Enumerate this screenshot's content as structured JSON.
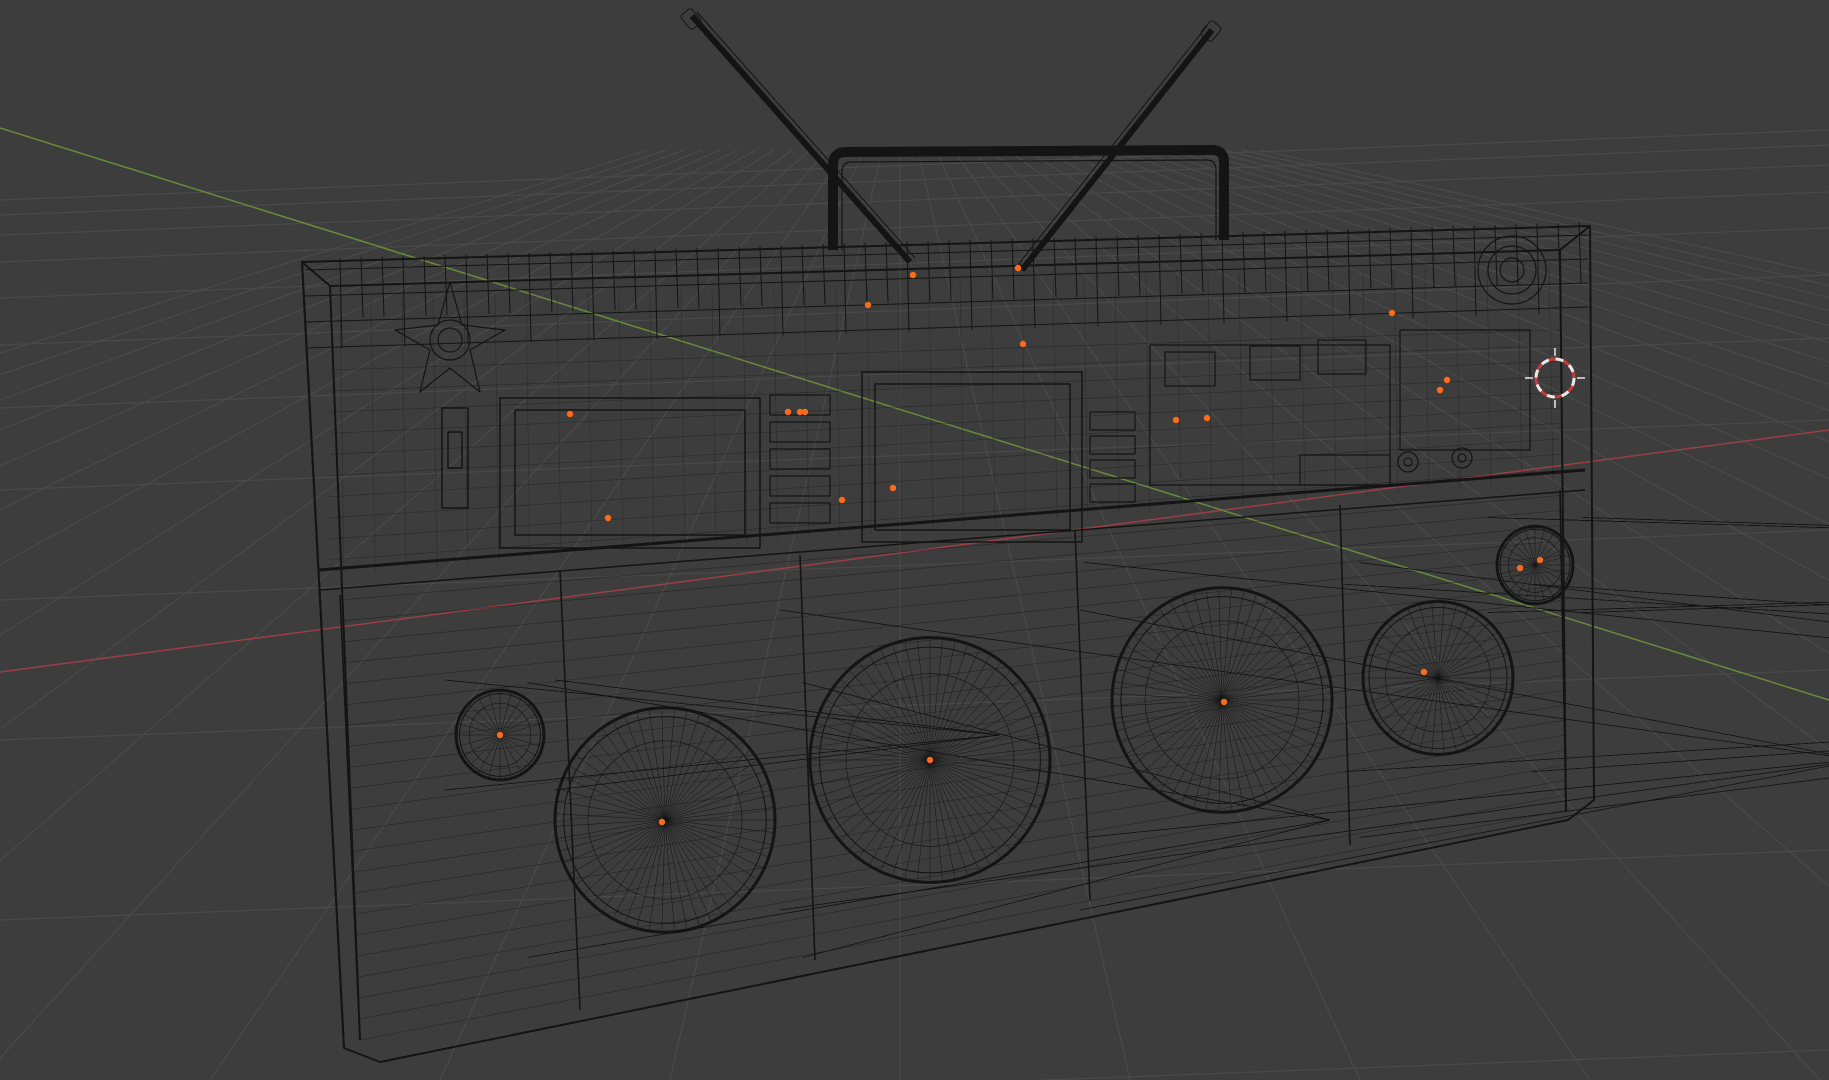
{
  "app": {
    "name": "3D viewport",
    "shading_mode": "wireframe",
    "object": "boombox"
  },
  "colors": {
    "background": "#3d3d3d",
    "grid": "#4a4a4a",
    "x_axis": "#9a3f48",
    "y_axis": "#6a8a3a",
    "wire": "#141414",
    "origin_points": "#ff6a1a",
    "cursor": "#e8e8e8",
    "cursor_accent": "#c63c3c"
  },
  "icons": {
    "cursor": "3d-cursor-icon"
  }
}
